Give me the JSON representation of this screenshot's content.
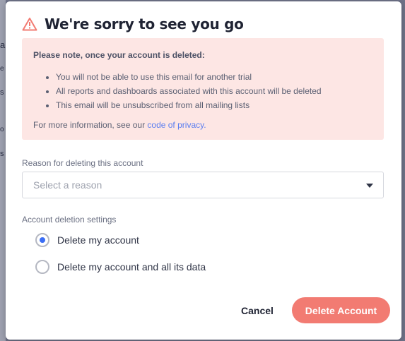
{
  "backdrop": {
    "fragments": [
      "a",
      "e",
      "s",
      "o",
      "s"
    ]
  },
  "dialog": {
    "title": "We're sorry to see you go",
    "warning_icon": "warning-triangle-icon",
    "accent_color": "#f27b72",
    "notice": {
      "heading": "Please note, once your account is deleted:",
      "items": [
        "You will not be able to use this email for another trial",
        "All reports and dashboards associated with this account will be deleted",
        "This email will be unsubscribed from all mailing lists"
      ],
      "more_prefix": "For more information, see our ",
      "more_link": "code of privacy."
    },
    "reason": {
      "label": "Reason for deleting this account",
      "placeholder": "Select a reason"
    },
    "settings": {
      "label": "Account deletion settings",
      "options": [
        {
          "label": "Delete my account",
          "selected": true
        },
        {
          "label": "Delete my account and all its data",
          "selected": false
        }
      ]
    },
    "actions": {
      "cancel": "Cancel",
      "delete": "Delete Account"
    }
  }
}
